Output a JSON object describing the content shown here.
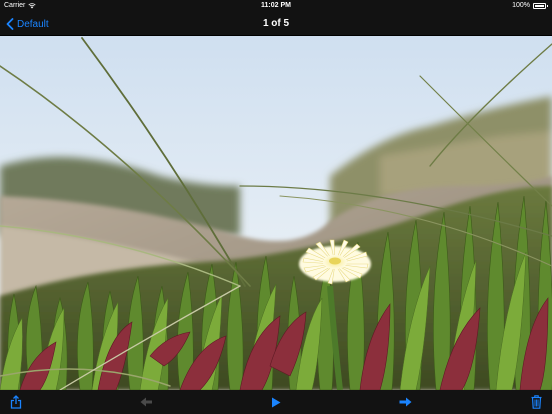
{
  "status_bar": {
    "carrier": "Carrier",
    "time": "11:02 PM",
    "battery_percent": "100%",
    "battery_level": 1.0
  },
  "nav_bar": {
    "back_label": "Default",
    "title": "1 of 5"
  },
  "photo": {
    "subject": "yellow ice-plant flower among succulent leaves and dune grass"
  },
  "toolbar": {
    "share_icon": "share-icon",
    "previous_icon": "arrow-left-icon",
    "play_icon": "play-icon",
    "next_icon": "arrow-right-icon",
    "delete_icon": "trash-icon",
    "previous_enabled": false
  },
  "colors": {
    "accent": "#1a84ff",
    "bar_background": "#121212",
    "disabled": "#4a4a4a"
  }
}
